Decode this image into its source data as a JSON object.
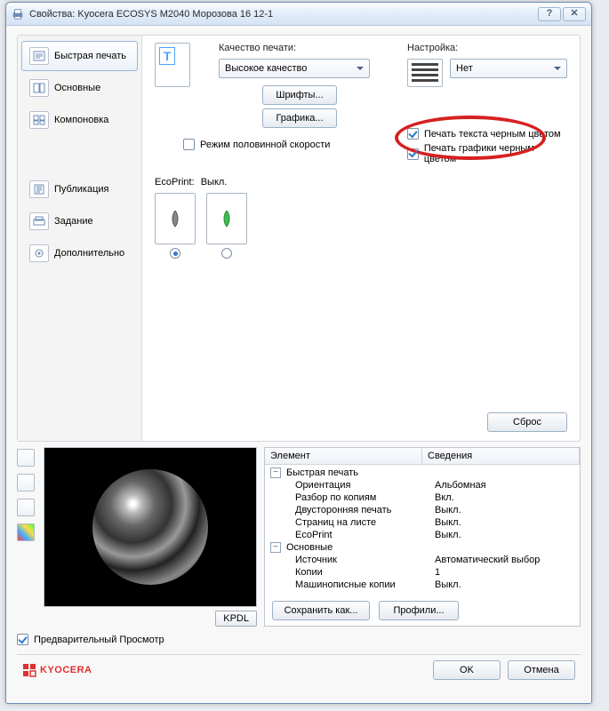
{
  "window": {
    "title": "Свойства: Kyocera ECOSYS M2040 Морозова 16 12-1"
  },
  "tabs": {
    "items": [
      {
        "label": "Быстрая печать",
        "active": true
      },
      {
        "label": "Основные",
        "active": false
      },
      {
        "label": "Компоновка",
        "active": false
      },
      {
        "label": "Публикация",
        "active": false
      },
      {
        "label": "Задание",
        "active": false
      },
      {
        "label": "Дополнительно",
        "active": false
      }
    ]
  },
  "quality": {
    "label": "Качество печати:",
    "selected": "Высокое качество",
    "fonts_btn": "Шрифты...",
    "graphics_btn": "Графика...",
    "half_speed": "Режим половинной скорости"
  },
  "settings": {
    "label": "Настройка:",
    "selected": "Нет",
    "text_black": "Печать текста черным цветом",
    "gfx_black": "Печать графики черным цветом"
  },
  "ecoprint": {
    "label": "EcoPrint:",
    "status": "Выкл."
  },
  "reset_btn": "Сброс",
  "preview_badge": "KPDL",
  "preview_checkbox": "Предварительный Просмотр",
  "details": {
    "col1": "Элемент",
    "col2": "Сведения",
    "groups": [
      {
        "name": "Быстрая печать",
        "rows": [
          {
            "k": "Ориентация",
            "v": "Альбомная"
          },
          {
            "k": "Разбор по копиям",
            "v": "Вкл."
          },
          {
            "k": "Двусторонняя печать",
            "v": "Выкл."
          },
          {
            "k": "Страниц на листе",
            "v": "Выкл."
          },
          {
            "k": "EcoPrint",
            "v": "Выкл."
          }
        ]
      },
      {
        "name": "Основные",
        "rows": [
          {
            "k": "Источник",
            "v": "Автоматический выбор"
          },
          {
            "k": "Копии",
            "v": "1"
          },
          {
            "k": "Машинописные копии",
            "v": "Выкл."
          }
        ]
      }
    ],
    "save_as": "Сохранить как...",
    "profiles": "Профили..."
  },
  "brand": "KYOCERA",
  "buttons": {
    "ok": "OK",
    "cancel": "Отмена"
  }
}
